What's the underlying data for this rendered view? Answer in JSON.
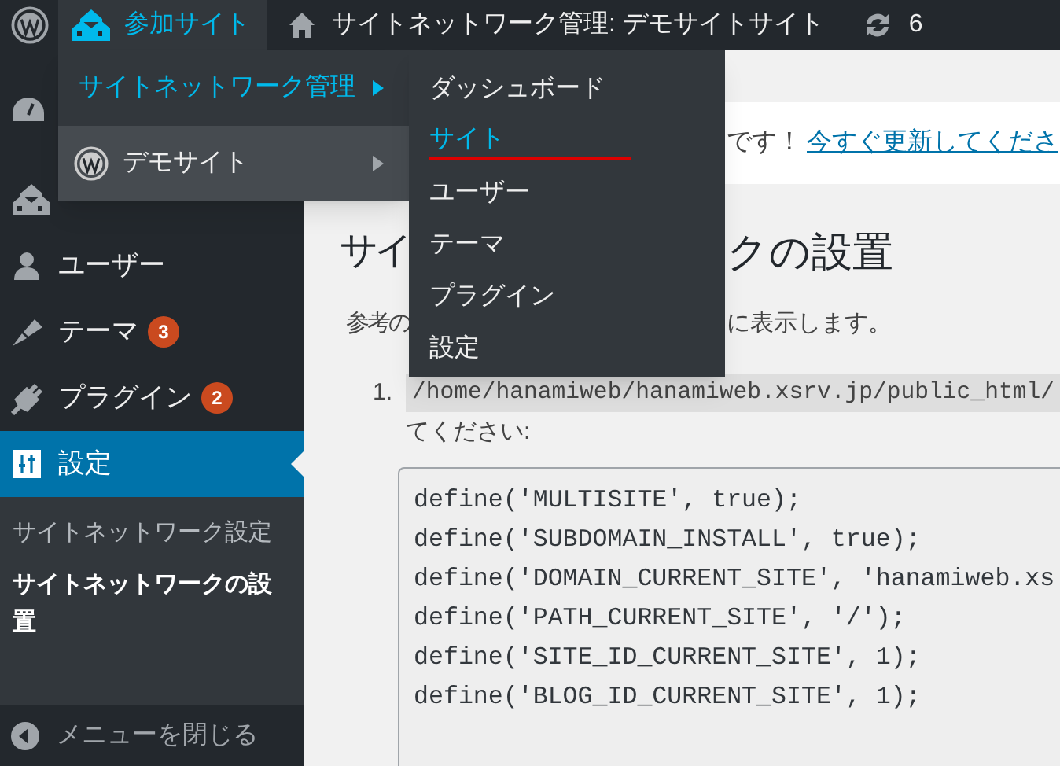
{
  "admin_bar": {
    "my_sites": {
      "label": "参加サイト",
      "selected": true
    },
    "network": {
      "label": "サイトネットワーク管理: デモサイトサイト"
    },
    "updates": {
      "count": "6"
    }
  },
  "my_sites_menu": [
    {
      "kind": "network",
      "label": "サイトネットワーク管理",
      "selected": true,
      "highlighted": false
    },
    {
      "kind": "site",
      "label": "デモサイト",
      "selected": false,
      "highlighted": true
    }
  ],
  "network_admin_menu": [
    {
      "label": "ダッシュボード",
      "selected": false
    },
    {
      "label": "サイト",
      "selected": true
    },
    {
      "label": "ユーザー",
      "selected": false
    },
    {
      "label": "テーマ",
      "selected": false
    },
    {
      "label": "プラグイン",
      "selected": false
    },
    {
      "label": "設定",
      "selected": false
    }
  ],
  "sidebar": {
    "items": [
      {
        "kind": "dashboard",
        "selected": false
      },
      {
        "kind": "sites",
        "selected": false
      },
      {
        "kind": "users",
        "label": "ユーザー",
        "selected": false
      },
      {
        "kind": "themes",
        "label": "テーマ",
        "badge": "3",
        "selected": false
      },
      {
        "kind": "plugins",
        "label": "プラグイン",
        "badge": "2",
        "selected": false
      },
      {
        "kind": "settings",
        "label": "設定",
        "selected": true,
        "children": [
          {
            "label": "サイトネットワーク設定",
            "selected": false
          },
          {
            "label": "サイトネットワークの設置",
            "selected": true
          }
        ]
      }
    ],
    "collapse": "メニューを閉じる"
  },
  "notice": {
    "text": "です！",
    "link": "今すぐ更新してくださ"
  },
  "page": {
    "title_parts": [
      "サイ",
      "クの設置"
    ],
    "intro_parts": [
      "参考の",
      "に表示します。"
    ],
    "steps": [
      {
        "number": "1.",
        "path": "/home/hanamiweb/hanamiweb.xsrv.jp/public_html/",
        "text": "てください:"
      }
    ],
    "code_lines": [
      "define('MULTISITE', true);",
      "define('SUBDOMAIN_INSTALL', true);",
      "define('DOMAIN_CURRENT_SITE', 'hanamiweb.xs",
      "define('PATH_CURRENT_SITE', '/');",
      "define('SITE_ID_CURRENT_SITE', 1);",
      "define('BLOG_ID_CURRENT_SITE', 1);"
    ]
  }
}
